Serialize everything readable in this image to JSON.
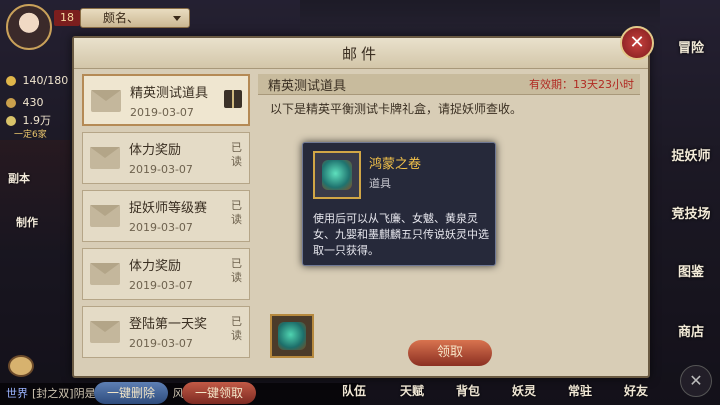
{
  "hud": {
    "level": "18",
    "player_name": "颇名、",
    "stamina": "140/180",
    "gold": "430",
    "other_value": "1.9万",
    "sub_label": "一定6家",
    "left_labels": [
      "副本",
      "制作"
    ]
  },
  "mail": {
    "title": "邮件",
    "items": [
      {
        "title": "精英测试道具",
        "date": "2019-03-07",
        "status": "",
        "selected": true
      },
      {
        "title": "体力奖励",
        "date": "2019-03-07",
        "status": "已读"
      },
      {
        "title": "捉妖师等级赛",
        "date": "2019-03-07",
        "status": "已读"
      },
      {
        "title": "体力奖励",
        "date": "2019-03-07",
        "status": "已读"
      },
      {
        "title": "登陆第一天奖",
        "date": "2019-03-07",
        "status": "已读"
      }
    ],
    "delete_all_label": "一键删除",
    "claim_all_label": "一键领取",
    "detail": {
      "title": "精英测试道具",
      "expiry": "有效期：13天23小时",
      "body": "以下是精英平衡测试卡牌礼盒，请捉妖师查收。",
      "claim_label": "领取"
    }
  },
  "tooltip": {
    "name": "鸿蒙之卷",
    "type": "道具",
    "description": "使用后可以从飞廉、女魃、黄泉灵女、九婴和墨麒麟五只传说妖灵中选取一只获得。"
  },
  "right_nav": [
    "冒险",
    "捉妖师",
    "竞技场",
    "图鉴",
    "商店"
  ],
  "bottom_menu": [
    "队伍",
    "天赋",
    "背包",
    "妖灵",
    "常驻",
    "好友"
  ],
  "chat": {
    "channel": "世界",
    "text": "[封之双]阴是怡不能复活的，风有影"
  },
  "colors": {
    "accent_red": "#b12a22",
    "item_gold": "#f3c24a",
    "panel": "#d8cdb6"
  }
}
